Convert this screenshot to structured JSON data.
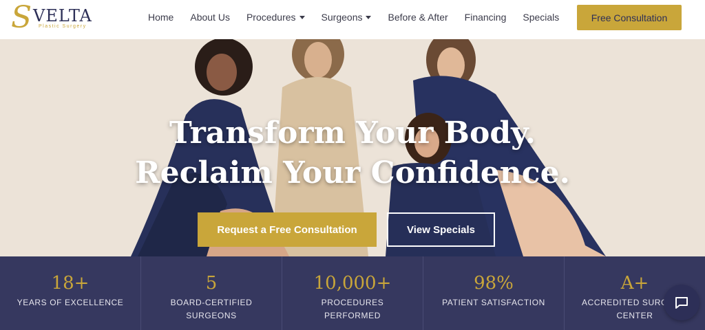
{
  "brand": {
    "logo_text": "SVELTA",
    "logo_sub": "Plastic Surgery"
  },
  "nav": {
    "items": [
      {
        "label": "Home",
        "has_caret": false
      },
      {
        "label": "About Us",
        "has_caret": false
      },
      {
        "label": "Procedures",
        "has_caret": true
      },
      {
        "label": "Surgeons",
        "has_caret": true
      },
      {
        "label": "Before & After",
        "has_caret": false
      },
      {
        "label": "Financing",
        "has_caret": false
      },
      {
        "label": "Specials",
        "has_caret": false
      }
    ],
    "cta_label": "Free Consultation"
  },
  "hero": {
    "title_line1": "Transform Your Body.",
    "title_line2": "Reclaim Your Confidence.",
    "primary_button": "Request a Free Consultation",
    "secondary_button": "View Specials"
  },
  "stats": [
    {
      "value": "18+",
      "label": "YEARS OF EXCELLENCE"
    },
    {
      "value": "5",
      "label": "BOARD-CERTIFIED SURGEONS"
    },
    {
      "value": "10,000+",
      "label": "PROCEDURES PERFORMED"
    },
    {
      "value": "98%",
      "label": "PATIENT SATISFACTION"
    },
    {
      "value": "A+",
      "label": "ACCREDITED SURGICAL CENTER"
    }
  ],
  "colors": {
    "gold": "#c9a63a",
    "navy": "#36385f",
    "text": "#3b3b4a"
  },
  "icons": {
    "chat": "chat-bubble-icon"
  }
}
